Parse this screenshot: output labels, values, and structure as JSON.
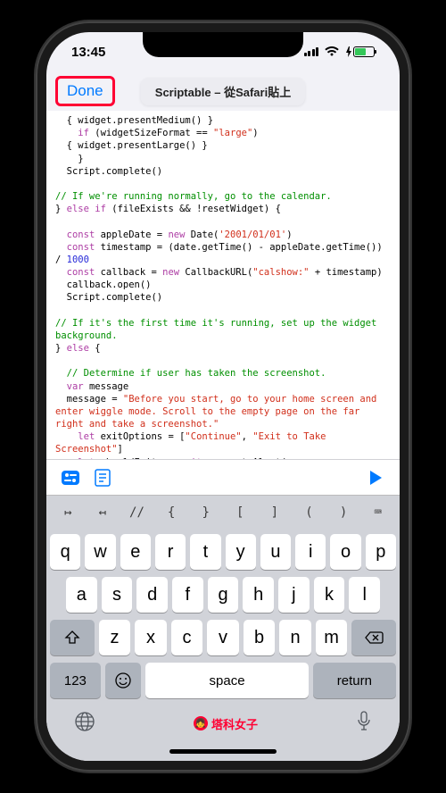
{
  "status": {
    "time": "13:45"
  },
  "nav": {
    "done": "Done",
    "title": "Scriptable – 從Safari貼上"
  },
  "code": {
    "l1a": "  { widget.presentMedium() }",
    "l2a": "    if",
    "l2b": " (widgetSizeFormat == ",
    "l2c": "\"large\"",
    "l2d": ")",
    "l3a": "  { widget.presentLarge() }",
    "l4a": "    }",
    "l5a": "  Script.complete()",
    "c1": "// If we're running normally, go to the calendar.",
    "l6a": "} ",
    "l6b": "else if",
    "l6c": " (fileExists && !resetWidget) {",
    "l7a": "  const",
    "l7b": " appleDate = ",
    "l7c": "new",
    "l7d": " Date(",
    "l7e": "'2001/01/01'",
    "l7f": ")",
    "l8a": "  const",
    "l8b": " timestamp = (date.getTime() - appleDate.getTime()) / ",
    "l8c": "1000",
    "l9a": "  const",
    "l9b": " callback = ",
    "l9c": "new",
    "l9d": " CallbackURL(",
    "l9e": "\"calshow:\"",
    "l9f": " + timestamp)",
    "l10": "  callback.open()",
    "l11": "  Script.complete()",
    "c2": "// If it's the first time it's running, set up the widget background.",
    "l12a": "} ",
    "l12b": "else",
    "l12c": " {",
    "c3": "  // Determine if user has taken the screenshot.",
    "l13a": "  var",
    "l13b": " message",
    "l14a": "  message = ",
    "l14b": "\"Before you start, go to your home screen and enter wiggle mode. Scroll to the empty page on the far right and take a screenshot.\"",
    "l15a": "    let",
    "l15b": " exitOptions = [",
    "l15c": "\"Continue\"",
    "l15d": ", ",
    "l15e": "\"Exit to Take Screenshot\"",
    "l15f": "]",
    "l16a": "    let",
    "l16b": " shouldExit = ",
    "l16c": "await",
    "l16d": " generateAlert(message,"
  },
  "symbols": [
    "↦",
    "↤",
    "//",
    "{",
    "}",
    "[",
    "]",
    "(",
    ")",
    "⌨"
  ],
  "rows": {
    "r1": [
      "q",
      "w",
      "e",
      "r",
      "t",
      "y",
      "u",
      "i",
      "o",
      "p"
    ],
    "r2": [
      "a",
      "s",
      "d",
      "f",
      "g",
      "h",
      "j",
      "k",
      "l"
    ],
    "r3": [
      "z",
      "x",
      "c",
      "v",
      "b",
      "n",
      "m"
    ]
  },
  "kb": {
    "num": "123",
    "space": "space",
    "ret": "return"
  },
  "brand": "塔科女子"
}
